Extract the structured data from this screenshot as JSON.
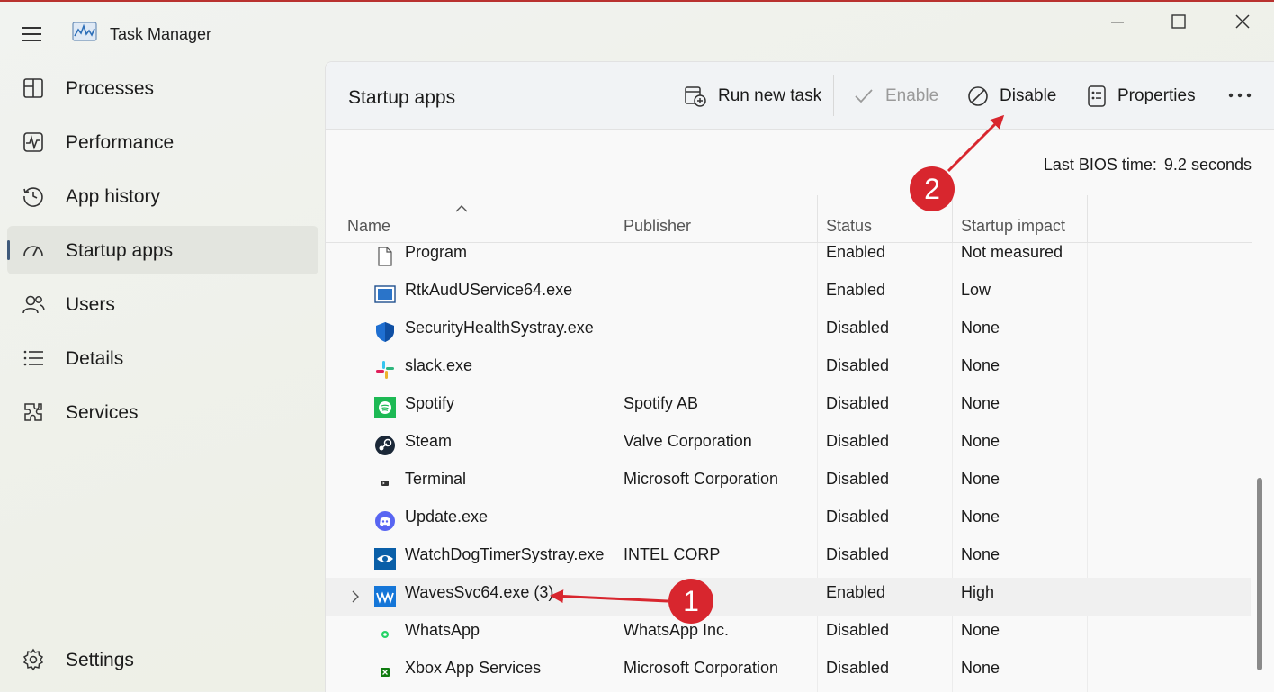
{
  "window": {
    "title": "Task Manager"
  },
  "sidebar": {
    "items": [
      {
        "label": "Processes",
        "icon": "processes-icon"
      },
      {
        "label": "Performance",
        "icon": "performance-icon"
      },
      {
        "label": "App history",
        "icon": "app-history-icon"
      },
      {
        "label": "Startup apps",
        "icon": "startup-apps-icon",
        "active": true
      },
      {
        "label": "Users",
        "icon": "users-icon"
      },
      {
        "label": "Details",
        "icon": "details-icon"
      },
      {
        "label": "Services",
        "icon": "services-icon"
      }
    ],
    "settings_label": "Settings"
  },
  "toolbar": {
    "page_title": "Startup apps",
    "run_new_task": "Run new task",
    "enable": "Enable",
    "disable": "Disable",
    "properties": "Properties"
  },
  "bios": {
    "label": "Last BIOS time:",
    "value": "9.2 seconds"
  },
  "table": {
    "headers": {
      "name": "Name",
      "publisher": "Publisher",
      "status": "Status",
      "impact": "Startup impact"
    },
    "rows": [
      {
        "name": "Program",
        "publisher": "",
        "status": "Enabled",
        "impact": "Not measured",
        "icon": "blank-file-icon"
      },
      {
        "name": "RtkAudUService64.exe",
        "publisher": "",
        "status": "Enabled",
        "impact": "Low",
        "icon": "realtek-icon"
      },
      {
        "name": "SecurityHealthSystray.exe",
        "publisher": "",
        "status": "Disabled",
        "impact": "None",
        "icon": "shield-icon"
      },
      {
        "name": "slack.exe",
        "publisher": "",
        "status": "Disabled",
        "impact": "None",
        "icon": "slack-icon"
      },
      {
        "name": "Spotify",
        "publisher": "Spotify AB",
        "status": "Disabled",
        "impact": "None",
        "icon": "spotify-icon"
      },
      {
        "name": "Steam",
        "publisher": "Valve Corporation",
        "status": "Disabled",
        "impact": "None",
        "icon": "steam-icon"
      },
      {
        "name": "Terminal",
        "publisher": "Microsoft Corporation",
        "status": "Disabled",
        "impact": "None",
        "icon": "terminal-icon"
      },
      {
        "name": "Update.exe",
        "publisher": "",
        "status": "Disabled",
        "impact": "None",
        "icon": "discord-icon"
      },
      {
        "name": "WatchDogTimerSystray.exe",
        "publisher": "INTEL CORP",
        "status": "Disabled",
        "impact": "None",
        "icon": "eye-icon"
      },
      {
        "name": "WavesSvc64.exe (3)",
        "publisher": "",
        "status": "Enabled",
        "impact": "High",
        "icon": "waves-icon",
        "highlighted": true
      },
      {
        "name": "WhatsApp",
        "publisher": "WhatsApp Inc.",
        "status": "Disabled",
        "impact": "None",
        "icon": "whatsapp-icon"
      },
      {
        "name": "Xbox App Services",
        "publisher": "Microsoft Corporation",
        "status": "Disabled",
        "impact": "None",
        "icon": "xbox-icon"
      }
    ]
  },
  "annotations": {
    "badge_1": "1",
    "badge_2": "2"
  },
  "colors": {
    "accent": "#3f5a7a",
    "annotation_red": "#d8262e"
  }
}
